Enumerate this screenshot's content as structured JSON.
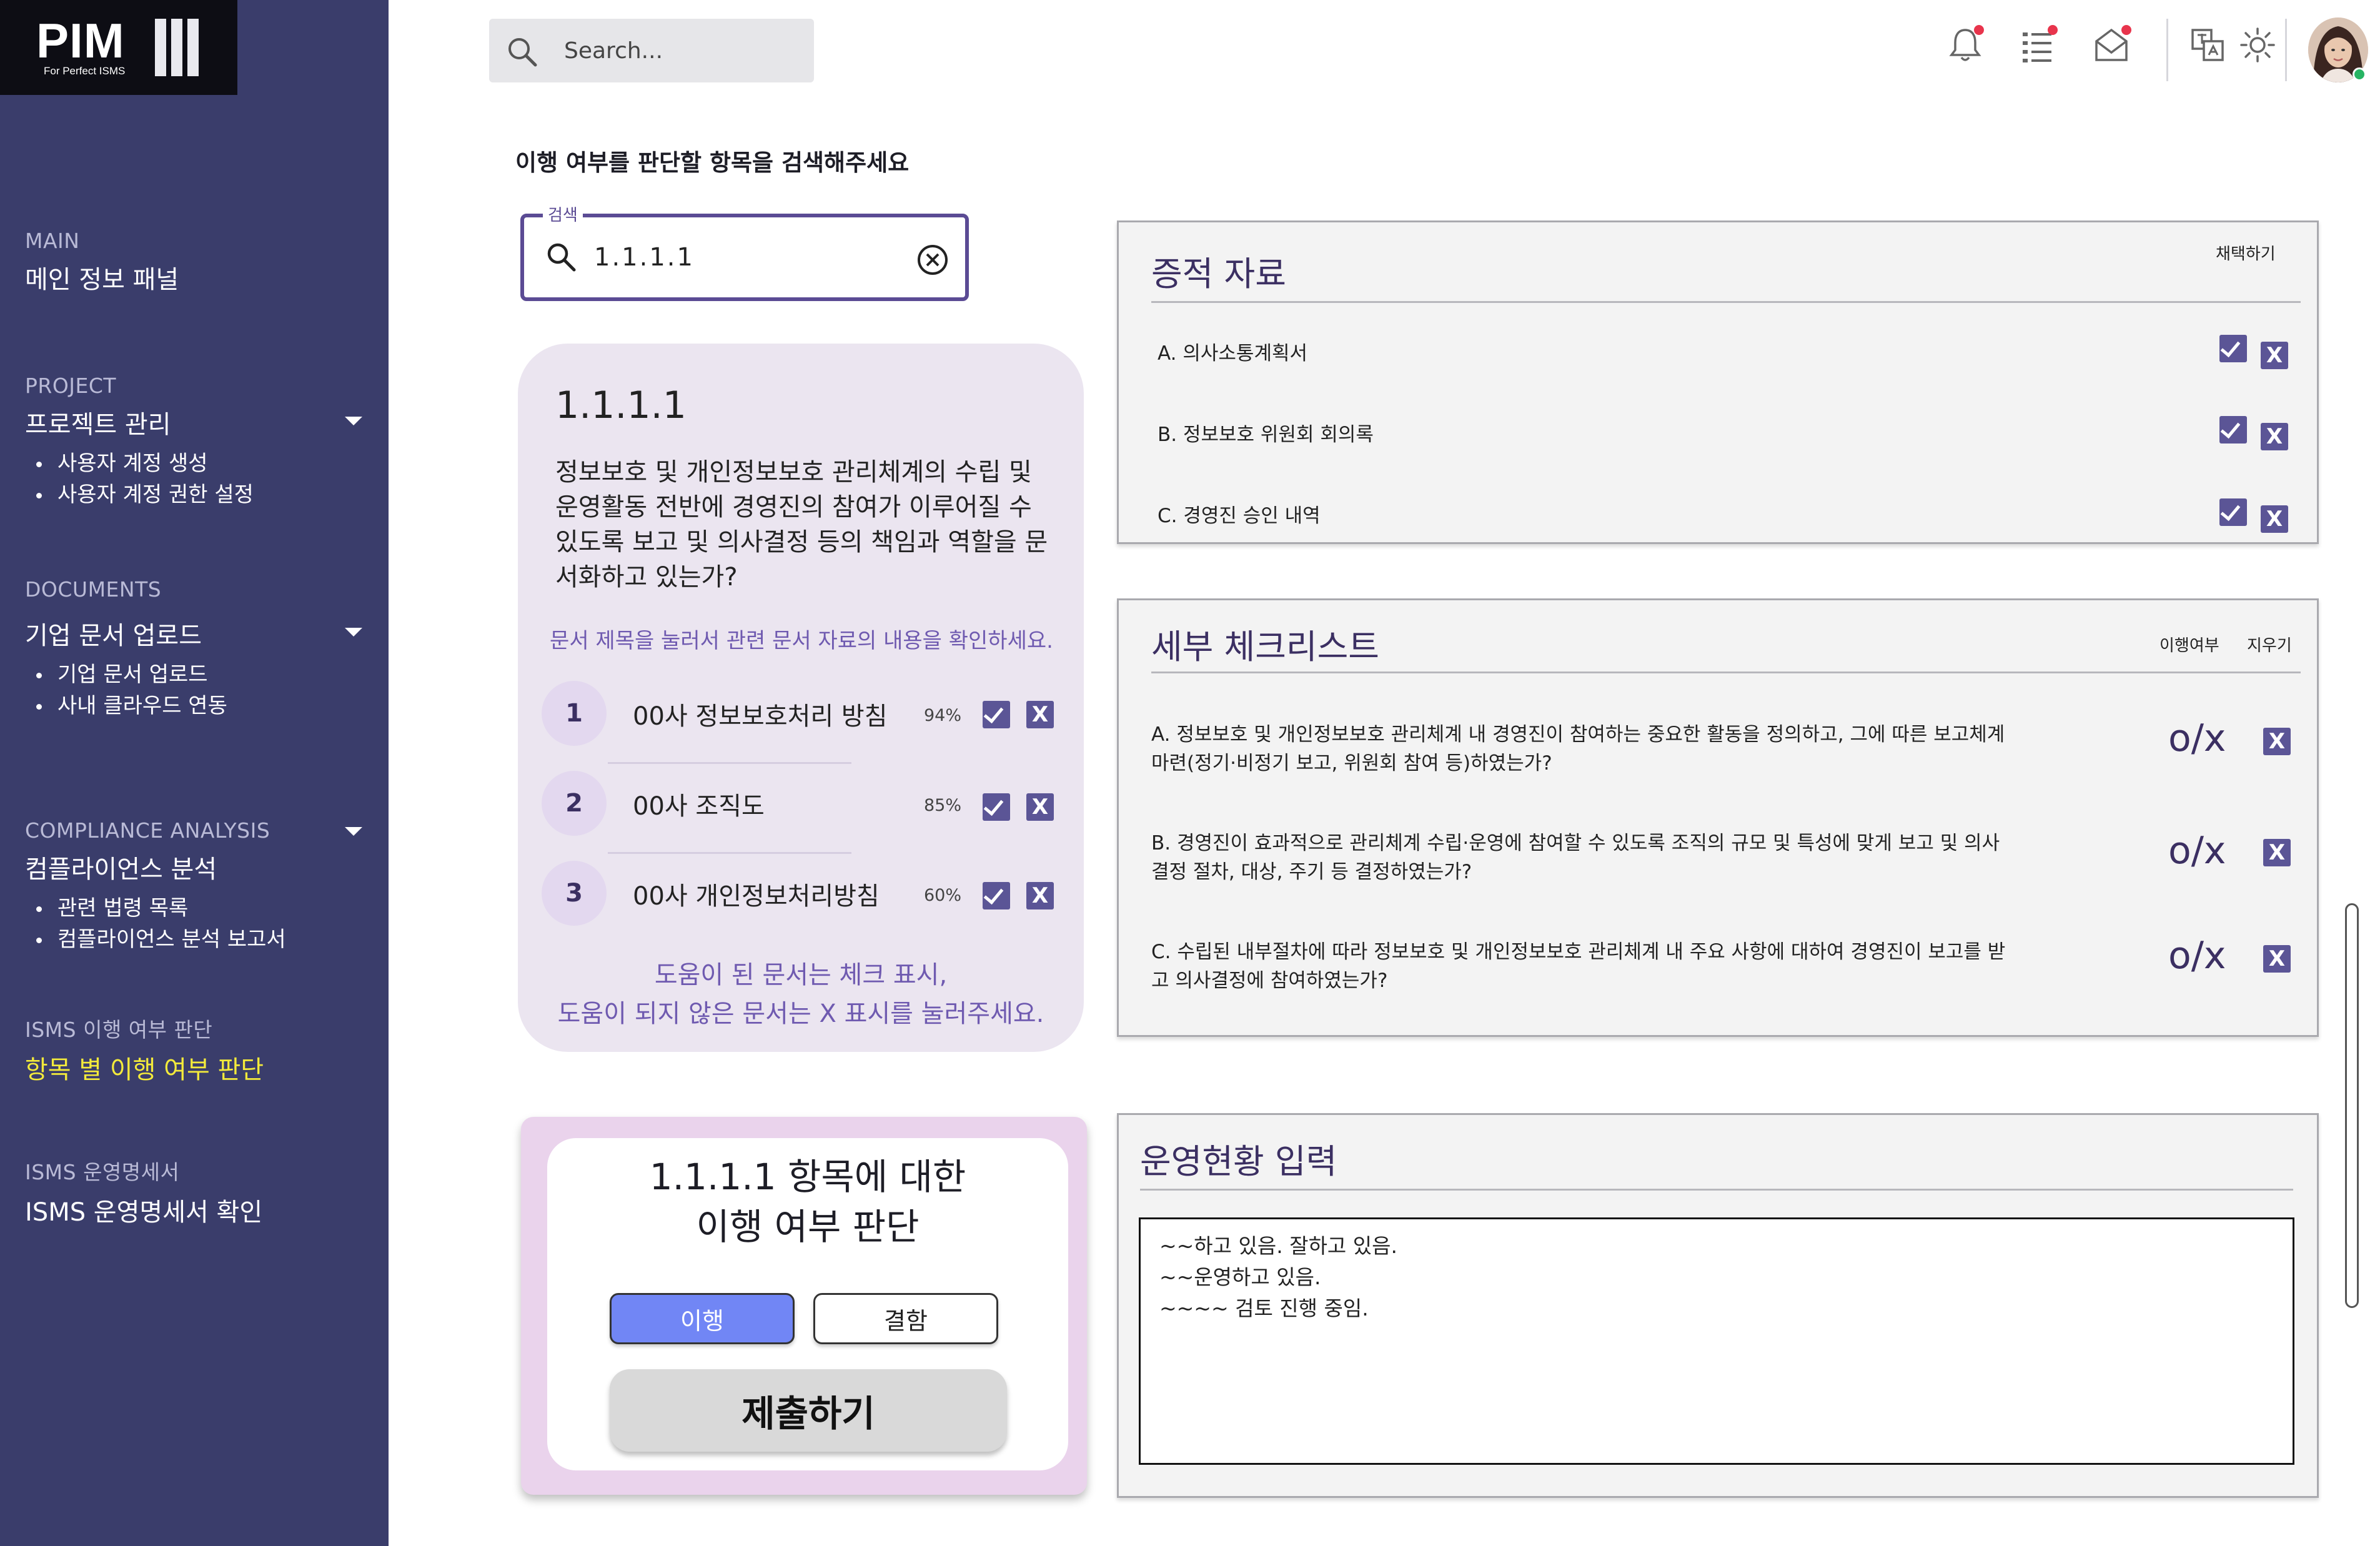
{
  "brand": {
    "name": "PIM",
    "tagline": "For Perfect ISMS"
  },
  "sidebar": {
    "sections": [
      {
        "category": "MAIN",
        "title": "메인 정보 패널",
        "items": []
      },
      {
        "category": "PROJECT",
        "title": "프로젝트 관리",
        "items": [
          "사용자 계정 생성",
          "사용자 계정 권한 설정"
        ]
      },
      {
        "category": "DOCUMENTS",
        "title": "기업 문서 업로드",
        "items": [
          "기업 문서 업로드",
          "사내 클라우드 연동"
        ]
      },
      {
        "category": "COMPLIANCE ANALYSIS",
        "title": "컴플라이언스 분석",
        "items": [
          "관련 법령 목록",
          "컴플라이언스 분석 보고서"
        ]
      },
      {
        "category": "ISMS 이행 여부 판단",
        "title": "항목 별 이행 여부 판단",
        "items": [],
        "active": true
      },
      {
        "category": "ISMS 운영명세서",
        "title": "ISMS 운영명세서 확인",
        "items": []
      }
    ]
  },
  "topbar": {
    "search_placeholder": "Search...",
    "icons": [
      "bell-icon",
      "list-icon",
      "mail-icon",
      "translate-icon",
      "sun-icon"
    ]
  },
  "main": {
    "prompt": "이행 여부를 판단할 항목을 검색해주세요",
    "search": {
      "legend": "검색",
      "value": "1.1.1.1"
    },
    "question": {
      "id": "1.1.1.1",
      "text": "정보보호 및 개인정보보호 관리체계의 수립 및 운영활동 전반에 경영진의 참여가 이루어질 수 있도록 보고 및 의사결정 등의 책임과 역할을 문서화하고 있는가?",
      "hint": "문서 제목을 눌러서 관련 문서 자료의 내용을 확인하세요.",
      "documents": [
        {
          "num": "1",
          "name": "00사 정보보호처리 방침",
          "pct": "94%"
        },
        {
          "num": "2",
          "name": "00사 조직도",
          "pct": "85%"
        },
        {
          "num": "3",
          "name": "00사 개인정보처리방침",
          "pct": "60%"
        }
      ],
      "footer_line1": "도움이 된 문서는 체크 표시,",
      "footer_line2": "도움이 되지 않은 문서는 X 표시를 눌러주세요."
    },
    "judgement": {
      "title_line1": "1.1.1.1 항목에 대한",
      "title_line2": "이행 여부 판단",
      "pass_label": "이행",
      "fail_label": "결함",
      "submit_label": "제출하기"
    }
  },
  "evidence": {
    "title": "증적 자료",
    "header_adopt": "채택하기",
    "items": [
      "A.  의사소통계획서",
      "B. 정보보호 위원회 회의록",
      "C. 경영진 승인 내역"
    ]
  },
  "checklist": {
    "title": "세부 체크리스트",
    "header_status": "이행여부",
    "header_delete": "지우기",
    "items": [
      {
        "text": "A.  정보보호 및 개인정보보호 관리체계 내 경영진이 참여하는 중요한 활동을 정의하고, 그에 따른 보고체계 마련(정기·비정기 보고, 위원회 참여 등)하였는가?",
        "status": "o/x"
      },
      {
        "text": "B. 경영진이 효과적으로 관리체계 수립·운영에 참여할 수 있도록 조직의 규모 및 특성에 맞게 보고 및 의사결정 절차, 대상, 주기 등 결정하였는가?",
        "status": "o/x"
      },
      {
        "text": "C. 수립된 내부절차에 따라 정보보호 및 개인정보보호 관리체계 내 주요 사항에 대하여 경영진이 보고를 받고 의사결정에 참여하였는가?",
        "status": "o/x"
      }
    ]
  },
  "operation": {
    "title": "운영현황 입력",
    "content": "~~하고 있음. 잘하고 있음.\n~~운영하고 있음.\n~~~~ 검토 진행 중임."
  },
  "colors": {
    "sidebar": "#3a3d6b",
    "accent": "#5b5596",
    "active_nav": "#f3ea3b",
    "pass_button": "#7186f5",
    "notification_dot": "#e8344c"
  }
}
